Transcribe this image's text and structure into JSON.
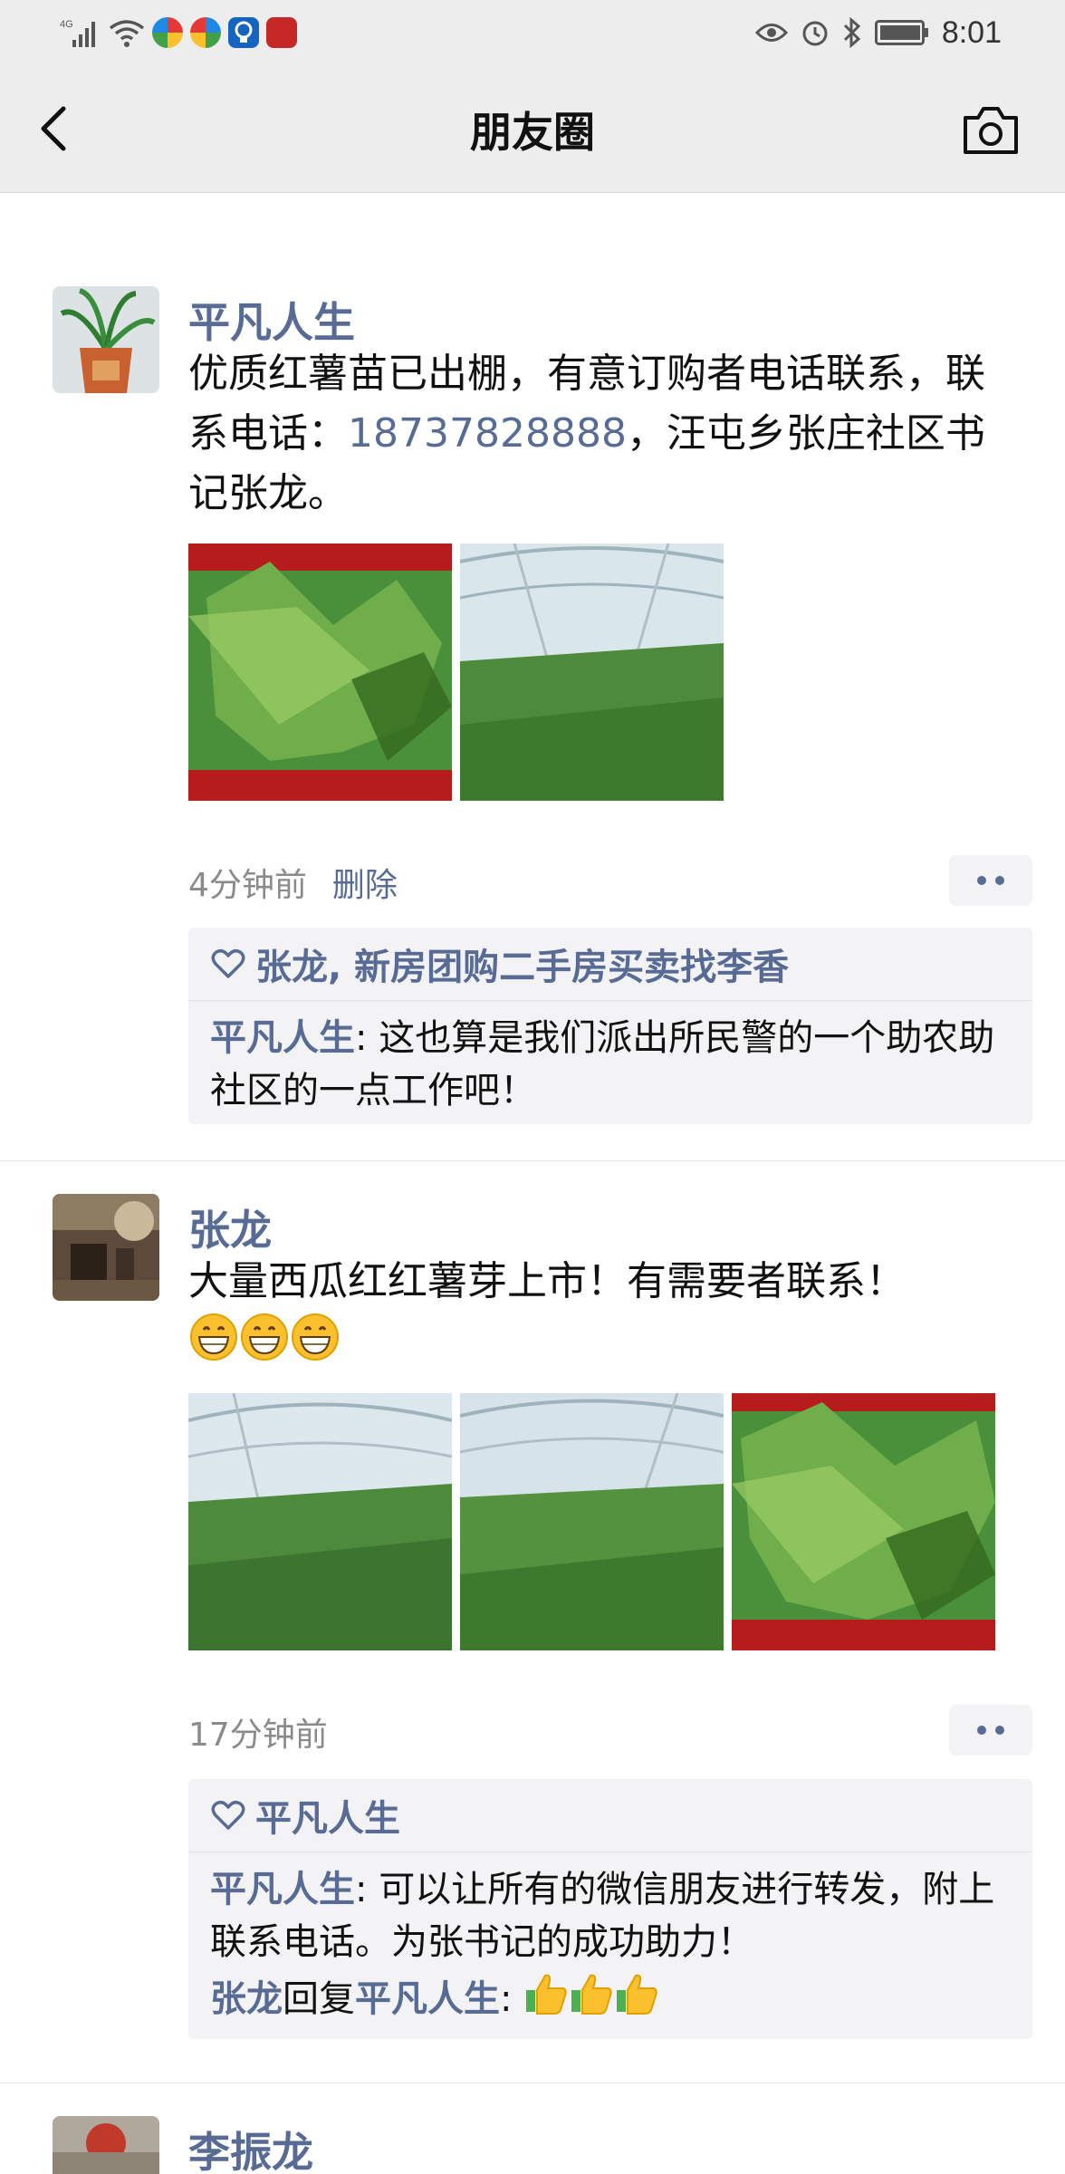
{
  "status_bar": {
    "signal_text": "4G",
    "time": "8:01"
  },
  "nav": {
    "title": "朋友圈"
  },
  "posts": [
    {
      "author": "平凡人生",
      "text_before_phone": "优质红薯苗已出棚，有意订购者电话联系，联系电话：",
      "phone": "18737828888",
      "text_after_phone": "，汪屯乡张庄社区书记张龙。",
      "time": "4分钟前",
      "delete_label": "删除",
      "likes": "张龙, 新房团购二手房买卖找李香",
      "comments": [
        {
          "author": "平凡人生",
          "sep": ": ",
          "text": "这也算是我们派出所民警的一个助农助社区的一点工作吧！"
        }
      ]
    },
    {
      "author": "张龙",
      "text": "大量西瓜红红薯芽上市！有需要者联系！",
      "emoji_name": "grin-emoji",
      "time": "17分钟前",
      "likes": "平凡人生",
      "comments": [
        {
          "author": "平凡人生",
          "sep": ": ",
          "text": "可以让所有的微信朋友进行转发，附上联系电话。为张书记的成功助力！"
        },
        {
          "author": "张龙",
          "reply_word": "回复",
          "reply_to": "平凡人生",
          "sep": ": ",
          "emoji_name": "thumbs-up-emoji"
        }
      ]
    },
    {
      "author": "李振龙"
    }
  ],
  "colors": {
    "name_blue": "#576b95",
    "bar_gray": "#ededed",
    "panel_gray": "#f3f3f5"
  }
}
